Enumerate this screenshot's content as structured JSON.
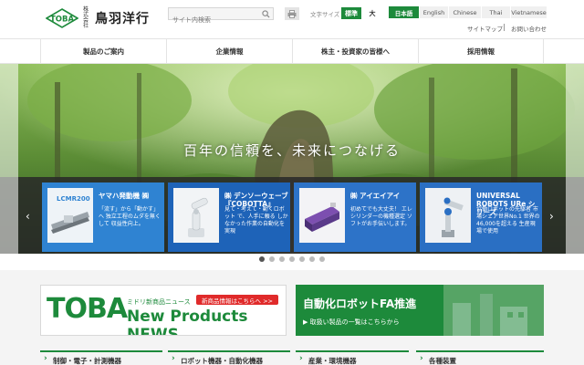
{
  "header": {
    "logo_mark": "TOBA",
    "logo_kaisha": "株式会社",
    "company_name": "鳥羽洋行",
    "search_placeholder": "サイト内検索",
    "fontsize_label": "文字サイズ",
    "fontsize_standard": "標準",
    "fontsize_large": "大",
    "languages": [
      "日本語",
      "English",
      "Chinese",
      "Thai",
      "Vietnamese"
    ],
    "sitemap": "サイトマップ",
    "contact": "お問い合わせ",
    "brand_color": "#1d8a3b"
  },
  "nav": {
    "items": [
      "製品のご案内",
      "企業情報",
      "株主・投資家の皆様へ",
      "採用情報"
    ]
  },
  "hero": {
    "tagline": "百年の信頼を、未来につなげる",
    "cards": [
      {
        "title": "ヤマハ発動機 ㈱",
        "thumb": "LCMR200",
        "body": "「流す」から「動かす」へ 独立工程のムダを無くして 収益性向上。"
      },
      {
        "title": "㈱ デンソーウェーブ 『COBOTTA』",
        "body": "見て・考えて・動くロボット で、人手に頼る しかなかった作業の自動化を実現"
      },
      {
        "title": "㈱ アイエイアイ",
        "body": "初めてでも大丈夫！ エレシリンダーの機種選定 ソフトがお手伝いします。"
      },
      {
        "title": "UNIVERSAL ROBOTS URe シリーズ",
        "body": "協働ロボットの先駆者 市場シェア世界No.1 世界の46,000を超える 生産現場で使用"
      }
    ],
    "slide_count": 7,
    "active_slide": 1
  },
  "banners": {
    "toba_logo": "TOBA",
    "toba_sub": "ミドリ新商品ニュース",
    "toba_link": "新商品情報はこちらへ >>",
    "toba_news": "New Products NEWS",
    "fa_title": "自動化ロボットFA推進",
    "fa_sub": "▶ 取扱い製品の一覧はこちらから"
  },
  "categories": [
    "制御・電子・計測機器",
    "ロボット機器・自動化機器",
    "産業・環境機器",
    "各種装置"
  ]
}
